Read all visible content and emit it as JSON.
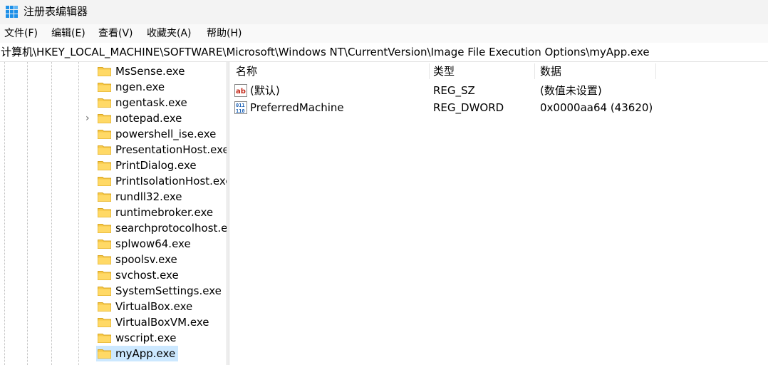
{
  "window": {
    "title": "注册表编辑器"
  },
  "menu": [
    "文件(F)",
    "编辑(E)",
    "查看(V)",
    "收藏夹(A)",
    "帮助(H)"
  ],
  "address": "计算机\\HKEY_LOCAL_MACHINE\\SOFTWARE\\Microsoft\\Windows NT\\CurrentVersion\\Image File Execution Options\\myApp.exe",
  "tree": {
    "items": [
      {
        "label": "MsSense.exe"
      },
      {
        "label": "ngen.exe"
      },
      {
        "label": "ngentask.exe"
      },
      {
        "label": "notepad.exe",
        "expander": "›"
      },
      {
        "label": "powershell_ise.exe"
      },
      {
        "label": "PresentationHost.exe"
      },
      {
        "label": "PrintDialog.exe"
      },
      {
        "label": "PrintIsolationHost.exe"
      },
      {
        "label": "rundll32.exe"
      },
      {
        "label": "runtimebroker.exe"
      },
      {
        "label": "searchprotocolhost.exe"
      },
      {
        "label": "splwow64.exe"
      },
      {
        "label": "spoolsv.exe"
      },
      {
        "label": "svchost.exe"
      },
      {
        "label": "SystemSettings.exe"
      },
      {
        "label": "VirtualBox.exe"
      },
      {
        "label": "VirtualBoxVM.exe"
      },
      {
        "label": "wscript.exe"
      },
      {
        "label": "myApp.exe",
        "selected": true
      }
    ]
  },
  "list": {
    "headers": [
      "名称",
      "类型",
      "数据"
    ],
    "rows": [
      {
        "name": "(默认)",
        "type": "REG_SZ",
        "data": "(数值未设置)",
        "icon": "string-value-icon"
      },
      {
        "name": "PreferredMachine",
        "type": "REG_DWORD",
        "data": "0x0000aa64 (43620)",
        "icon": "binary-value-icon"
      }
    ]
  },
  "colors": {
    "selected": "#cce8ff",
    "folder": "#f7c948",
    "icon_red": "#c42b1c",
    "icon_blue": "#1a5fb4"
  }
}
